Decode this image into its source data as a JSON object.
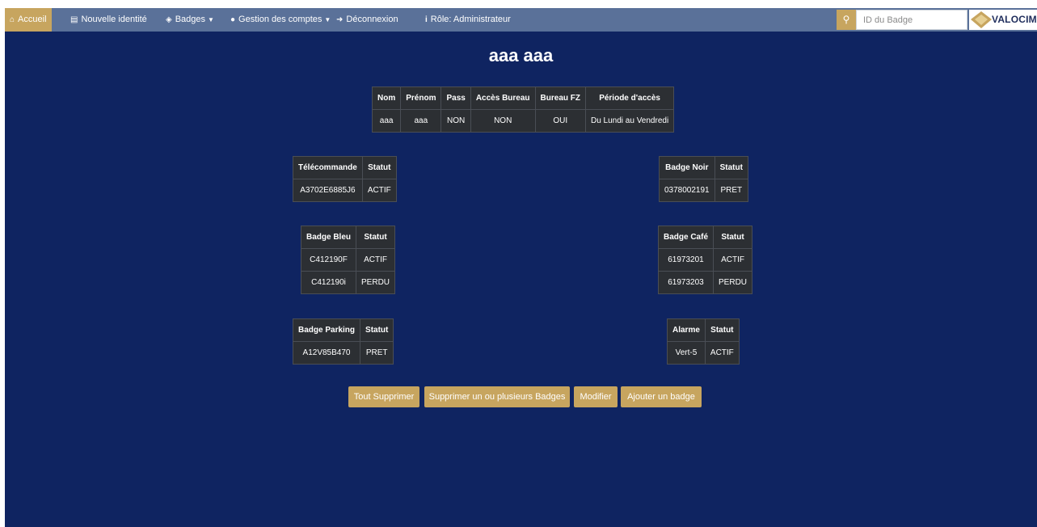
{
  "nav": {
    "accueil": "Accueil",
    "nouvelle_identite": "Nouvelle identité",
    "badges": "Badges",
    "gestion_comptes": "Gestion des comptes",
    "deconnexion": "Déconnexion",
    "role": "Rôle: Administrateur",
    "search_placeholder": "ID du Badge",
    "logo_text": "VALOCIM"
  },
  "colors": {
    "background": "#0f2461",
    "navbar": "#5a7199",
    "accent": "#c7a55f",
    "table_bg": "#2c2f33"
  },
  "title": "aaa aaa",
  "identity": {
    "headers": [
      "Nom",
      "Prénom",
      "Pass",
      "Accès Bureau",
      "Bureau FZ",
      "Période d'accès"
    ],
    "row": [
      "aaa",
      "aaa",
      "NON",
      "NON",
      "OUI",
      "Du Lundi au Vendredi"
    ]
  },
  "telecommande": {
    "headers": [
      "Télécommande",
      "Statut"
    ],
    "rows": [
      [
        "A3702E6885J6",
        "ACTIF"
      ]
    ]
  },
  "badge_noir": {
    "headers": [
      "Badge Noir",
      "Statut"
    ],
    "rows": [
      [
        "0378002191",
        "PRET"
      ]
    ]
  },
  "badge_bleu": {
    "headers": [
      "Badge Bleu",
      "Statut"
    ],
    "rows": [
      [
        "C412190F",
        "ACTIF"
      ],
      [
        "C412190i",
        "PERDU"
      ]
    ]
  },
  "badge_cafe": {
    "headers": [
      "Badge Café",
      "Statut"
    ],
    "rows": [
      [
        "61973201",
        "ACTIF"
      ],
      [
        "61973203",
        "PERDU"
      ]
    ]
  },
  "badge_parking": {
    "headers": [
      "Badge Parking",
      "Statut"
    ],
    "rows": [
      [
        "A12V85B470",
        "PRET"
      ]
    ]
  },
  "alarme": {
    "headers": [
      "Alarme",
      "Statut"
    ],
    "rows": [
      [
        "Vert-5",
        "ACTIF"
      ]
    ]
  },
  "buttons": {
    "tout_supprimer": "Tout Supprimer",
    "supprimer_badges": "Supprimer un ou plusieurs Badges",
    "modifier": "Modifier",
    "ajouter_badge": "Ajouter un badge"
  }
}
